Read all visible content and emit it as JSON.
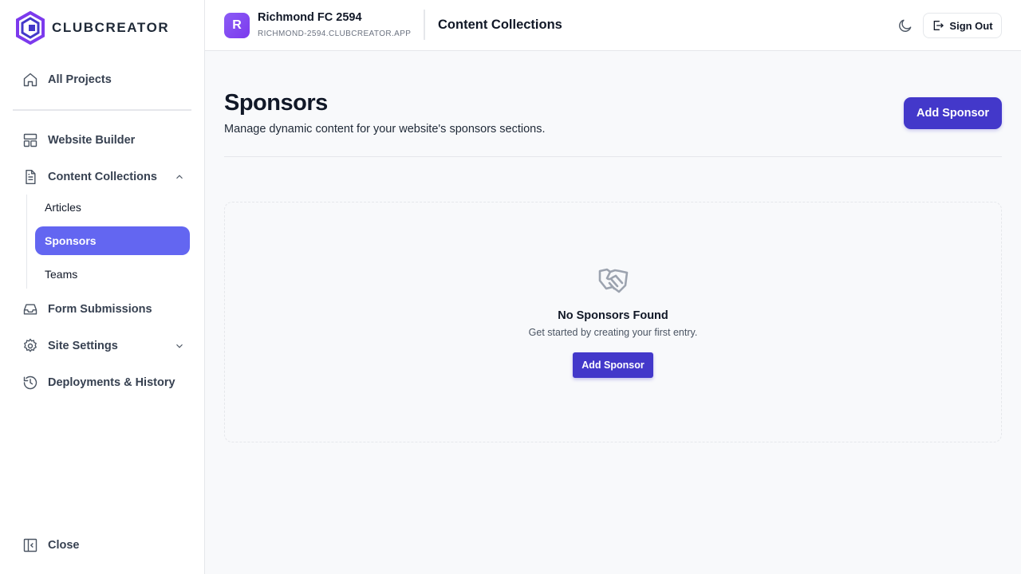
{
  "brand": {
    "name": "CLUBCREATOR",
    "accent": "#4338ca",
    "active_nav": "#6366f1"
  },
  "sidebar": {
    "items": [
      {
        "label": "All Projects",
        "icon": "home-icon"
      },
      {
        "label": "Website Builder",
        "icon": "layout-icon"
      },
      {
        "label": "Content Collections",
        "icon": "document-icon",
        "expanded": true
      },
      {
        "label": "Form Submissions",
        "icon": "inbox-icon"
      },
      {
        "label": "Site Settings",
        "icon": "gear-icon",
        "expanded": false
      },
      {
        "label": "Deployments & History",
        "icon": "history-icon"
      }
    ],
    "subitems": [
      {
        "label": "Articles",
        "active": false
      },
      {
        "label": "Sponsors",
        "active": true
      },
      {
        "label": "Teams",
        "active": false
      }
    ],
    "close_label": "Close"
  },
  "header": {
    "avatar_letter": "R",
    "project_name": "Richmond FC 2594",
    "project_url": "RICHMOND-2594.CLUBCREATOR.APP",
    "section_title": "Content Collections",
    "sign_out_label": "Sign Out"
  },
  "main": {
    "title": "Sponsors",
    "subtitle": "Manage dynamic content for your website's sponsors sections.",
    "add_button_label": "Add Sponsor",
    "empty_state": {
      "title": "No Sponsors Found",
      "subtitle": "Get started by creating your first entry.",
      "button_label": "Add Sponsor"
    }
  }
}
